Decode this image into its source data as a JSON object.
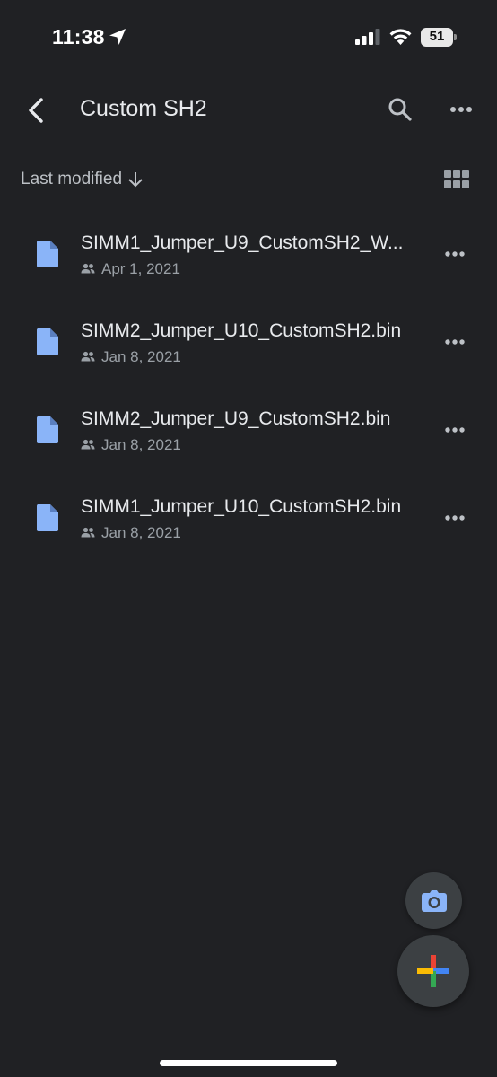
{
  "status_bar": {
    "time": "11:38",
    "battery_level": "51",
    "icons": [
      "location-arrow-icon",
      "cellular-signal-icon",
      "wifi-icon",
      "battery-icon"
    ]
  },
  "header": {
    "title": "Custom SH2",
    "icons": [
      "back-arrow-icon",
      "search-icon",
      "more-horizontal-icon"
    ]
  },
  "sort": {
    "label": "Last modified",
    "direction_icon": "arrow-down-icon",
    "view_toggle_icon": "grid-view-icon"
  },
  "files": [
    {
      "name": "SIMM1_Jumper_U9_CustomSH2_W...",
      "date": "Apr 1, 2021",
      "shared": true
    },
    {
      "name": "SIMM2_Jumper_U10_CustomSH2.bin",
      "date": "Jan 8, 2021",
      "shared": true
    },
    {
      "name": "SIMM2_Jumper_U9_CustomSH2.bin",
      "date": "Jan 8, 2021",
      "shared": true
    },
    {
      "name": "SIMM1_Jumper_U10_CustomSH2.bin",
      "date": "Jan 8, 2021",
      "shared": true
    }
  ],
  "fabs": {
    "camera_icon": "camera-icon",
    "new_icon": "plus-icon"
  },
  "colors": {
    "background": "#202124",
    "file_icon": "#8ab4f8",
    "fab_background": "#3c4043",
    "google_blue": "#4285f4",
    "google_red": "#ea4335",
    "google_yellow": "#fbbc04",
    "google_green": "#34a853"
  }
}
